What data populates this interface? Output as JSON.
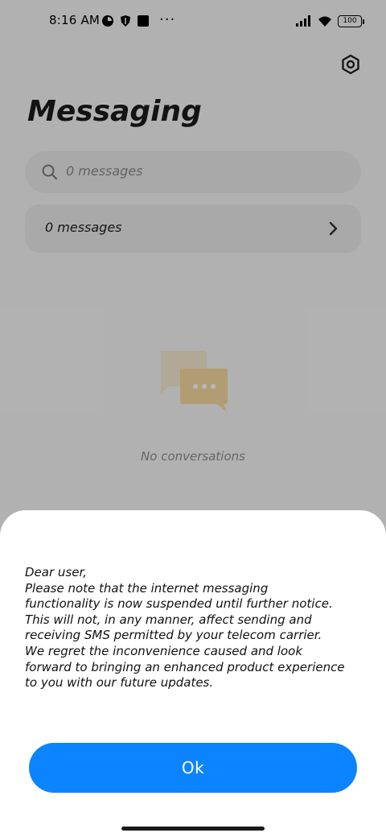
{
  "status_bar": {
    "time": "8:16 AM",
    "more": "···",
    "battery": "100"
  },
  "header": {
    "title": "Messaging",
    "settings_icon": "gear-icon"
  },
  "search": {
    "placeholder": "0 messages"
  },
  "messages_row": {
    "label": "0 messages"
  },
  "empty_state": {
    "text": "No conversations"
  },
  "dialog": {
    "message": "Dear user,\nPlease note that the internet messaging\nfunctionality is now suspended until further notice.\nThis will not, in any manner, affect sending and\nreceiving SMS permitted by your telecom carrier.\nWe regret the inconvenience caused and look\nforward to bringing an enhanced product experience\nto you with our future updates.",
    "ok_label": "Ok"
  },
  "colors": {
    "accent": "#0d84ff",
    "background": "#f6f6f6"
  }
}
